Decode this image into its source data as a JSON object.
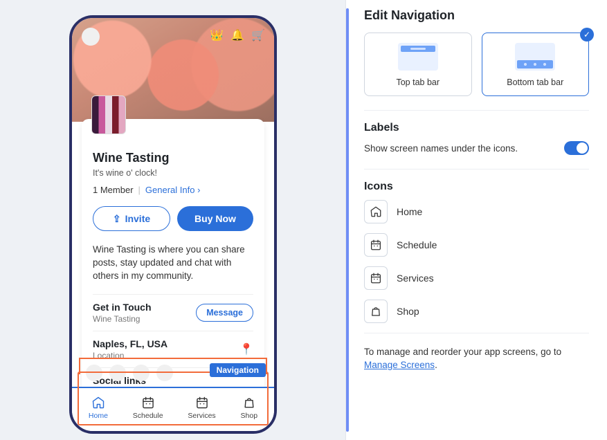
{
  "preview": {
    "title": "Wine Tasting",
    "tagline": "It's wine o' clock!",
    "member_count": "1 Member",
    "general_info_label": "General Info",
    "invite_label": "Invite",
    "buy_now_label": "Buy Now",
    "description": "Wine Tasting is where you can share posts, stay updated and chat with others in my community.",
    "contact": {
      "heading": "Get in Touch",
      "sub": "Wine Tasting",
      "cta": "Message"
    },
    "location": {
      "heading": "Naples, FL, USA",
      "sub": "Location"
    },
    "social_heading": "Social links",
    "nav_badge": "Navigation",
    "nav_items": [
      {
        "label": "Home",
        "icon": "home-icon",
        "active": true
      },
      {
        "label": "Schedule",
        "icon": "calendar-icon",
        "active": false
      },
      {
        "label": "Services",
        "icon": "calendar-icon",
        "active": false
      },
      {
        "label": "Shop",
        "icon": "bag-icon",
        "active": false
      }
    ]
  },
  "panel": {
    "title": "Edit Navigation",
    "options": [
      {
        "label": "Top tab bar",
        "selected": false
      },
      {
        "label": "Bottom tab bar",
        "selected": true
      }
    ],
    "labels_section": "Labels",
    "labels_toggle_text": "Show screen names under the icons.",
    "labels_toggle_on": true,
    "icons_section": "Icons",
    "icons": [
      {
        "label": "Home",
        "icon": "home-icon"
      },
      {
        "label": "Schedule",
        "icon": "calendar-icon"
      },
      {
        "label": "Services",
        "icon": "calendar-icon"
      },
      {
        "label": "Shop",
        "icon": "bag-icon"
      }
    ],
    "footer_prefix": "To manage and reorder your app screens, go to ",
    "footer_link": "Manage Screens",
    "footer_suffix": "."
  }
}
